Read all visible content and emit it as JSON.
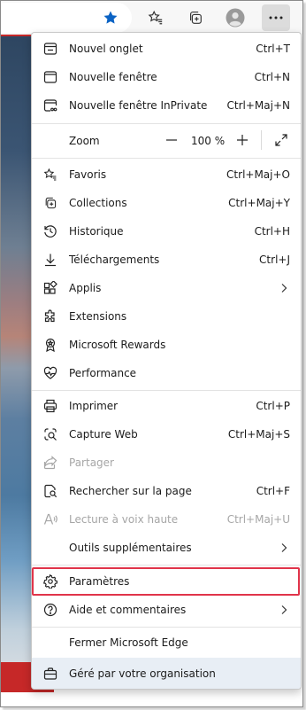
{
  "colors": {
    "accent_star": "#0b63c4",
    "highlight_border": "#e0344a",
    "managed_bg": "#e8eef5",
    "disabled_text": "#a6a6a6"
  },
  "toolbar": {
    "buttons": [
      {
        "name": "favorite-star-icon"
      },
      {
        "name": "favorites-icon"
      },
      {
        "name": "collections-icon"
      },
      {
        "name": "profile-avatar-icon"
      },
      {
        "name": "settings-and-more-icon",
        "active": true
      }
    ]
  },
  "menu": {
    "group1": [
      {
        "icon": "new-tab-icon",
        "label": "Nouvel onglet",
        "shortcut": "Ctrl+T"
      },
      {
        "icon": "new-window-icon",
        "label": "Nouvelle fenêtre",
        "shortcut": "Ctrl+N"
      },
      {
        "icon": "inprivate-window-icon",
        "label": "Nouvelle fenêtre InPrivate",
        "shortcut": "Ctrl+Maj+N"
      }
    ],
    "zoom": {
      "label": "Zoom",
      "value": "100 %"
    },
    "group2": [
      {
        "icon": "favorites-icon",
        "label": "Favoris",
        "shortcut": "Ctrl+Maj+O"
      },
      {
        "icon": "collections-icon",
        "label": "Collections",
        "shortcut": "Ctrl+Maj+Y"
      },
      {
        "icon": "history-icon",
        "label": "Historique",
        "shortcut": "Ctrl+H"
      },
      {
        "icon": "downloads-icon",
        "label": "Téléchargements",
        "shortcut": "Ctrl+J"
      },
      {
        "icon": "apps-icon",
        "label": "Applis",
        "submenu": true
      },
      {
        "icon": "extensions-icon",
        "label": "Extensions"
      },
      {
        "icon": "rewards-icon",
        "label": "Microsoft Rewards"
      },
      {
        "icon": "performance-icon",
        "label": "Performance"
      }
    ],
    "group3": [
      {
        "icon": "print-icon",
        "label": "Imprimer",
        "shortcut": "Ctrl+P"
      },
      {
        "icon": "web-capture-icon",
        "label": "Capture Web",
        "shortcut": "Ctrl+Maj+S"
      },
      {
        "icon": "share-icon",
        "label": "Partager",
        "disabled": true
      },
      {
        "icon": "find-on-page-icon",
        "label": "Rechercher sur la page",
        "shortcut": "Ctrl+F"
      },
      {
        "icon": "read-aloud-icon",
        "label": "Lecture à voix haute",
        "shortcut": "Ctrl+Maj+U",
        "disabled": true
      },
      {
        "label": "Outils supplémentaires",
        "submenu": true
      }
    ],
    "group4": [
      {
        "icon": "settings-gear-icon",
        "label": "Paramètres",
        "highlighted": true
      },
      {
        "icon": "help-icon",
        "label": "Aide et commentaires",
        "submenu": true
      }
    ],
    "close": {
      "label": "Fermer Microsoft Edge"
    },
    "managed": {
      "icon": "briefcase-icon",
      "label": "Géré par votre organisation"
    }
  }
}
